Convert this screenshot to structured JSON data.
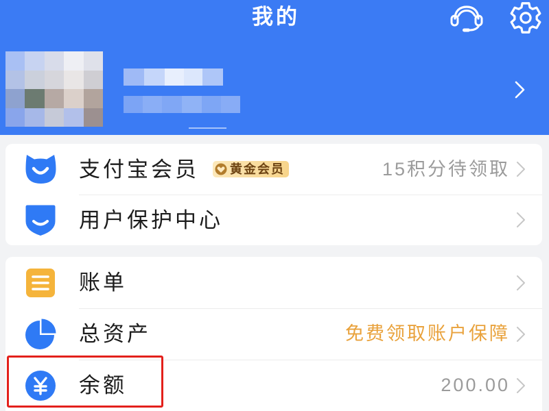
{
  "header": {
    "title": "我的",
    "actions": [
      {
        "icon": "headset-icon"
      },
      {
        "icon": "gear-icon"
      }
    ]
  },
  "profile": {
    "chevron_icon": "chevron-right-icon"
  },
  "membership_card": {
    "rows": [
      {
        "icon": "member-badge-icon",
        "label": "支付宝会员",
        "badge": {
          "icon": "gold-member-icon",
          "text": "黄金会员"
        },
        "detail": "15积分待领取",
        "chevron_icon": "chevron-right-icon"
      },
      {
        "icon": "shield-icon",
        "label": "用户保护中心",
        "chevron_icon": "chevron-right-icon"
      }
    ]
  },
  "finance_card": {
    "rows": [
      {
        "icon": "bill-list-icon",
        "label": "账单",
        "chevron_icon": "chevron-right-icon"
      },
      {
        "icon": "pie-chart-icon",
        "label": "总资产",
        "detail": "免费领取账户保障",
        "chevron_icon": "chevron-right-icon"
      },
      {
        "icon": "yuan-coin-icon",
        "label": "余额",
        "detail": "200.00",
        "chevron_icon": "chevron-right-icon"
      }
    ]
  },
  "colors": {
    "brand_blue": "#3b7bf4",
    "icon_blue": "#2f7af5",
    "page_background": "#f2f3f5",
    "card_background": "#ffffff",
    "label_text": "#1c1c1c",
    "muted_text": "#9b9b9b",
    "promo_orange": "#e9a23c",
    "bill_icon_orange": "#f5b43b",
    "gold_badge": "#f7d48a",
    "gold_badge_text": "#6e4413",
    "annotation_red": "#e3201b"
  }
}
